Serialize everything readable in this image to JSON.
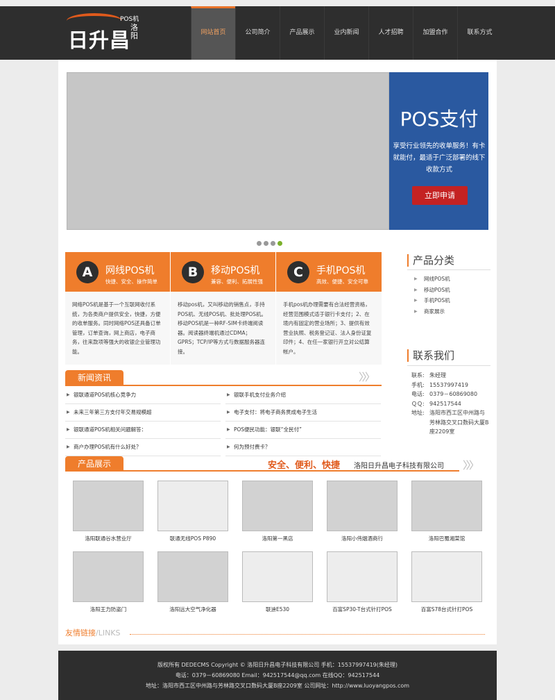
{
  "brand": {
    "logo_text": "日升昌",
    "logo_tag": "POS机",
    "logo_city": "洛阳"
  },
  "nav": [
    "网站首页",
    "公司简介",
    "产品展示",
    "业内新闻",
    "人才招聘",
    "加盟合作",
    "联系方式"
  ],
  "banner": {
    "title": "POS支付",
    "text": "享受行业领先的收单服务！有卡就能付，最适于广泛部署的线下收款方式",
    "button": "立即申请"
  },
  "features": [
    {
      "badge": "A",
      "title": "网线POS机",
      "sub": "快捷、安全、操作简单",
      "body": "网络POS机是基于一个互联网收付系统，为各类商户提供安全，快捷，方便的收单服务。同时网络POS还具备订单管理，订单查询，网上商店，电子商务，往来款项等强大的收银企业管理功能。"
    },
    {
      "badge": "B",
      "title": "移动POS机",
      "sub": "兼容、便利、拓展性强",
      "body": "移动pos机，又叫移动的销售点，手持POS机、无线POS机、批处理POS机。移动POS机是一种RF-SIM卡终端阅读器。阅读器终端机通过CDMA；GPRS；TCP/IP等方式与数据服务器连接。"
    },
    {
      "badge": "C",
      "title": "手机POS机",
      "sub": "高效、便捷、安全可靠",
      "body": "手机pos机办理需要有合法经营资格，经营范围模式适于银行卡支付；2、在境内有固定的营业场所；3、提供有效营业执照、税务登记证、法人身份证复印件；4、在任一家银行开立对公结算帐户。"
    }
  ],
  "sidebar": {
    "category_title": "产品分类",
    "categories": [
      "网线POS机",
      "移动POS机",
      "手机POS机",
      "商家展示"
    ],
    "contact_title": "联系我们",
    "contact": [
      {
        "k": "联系:",
        "v": "朱经理"
      },
      {
        "k": "手机:",
        "v": "15537997419"
      },
      {
        "k": "电话:",
        "v": "0379－60869080"
      },
      {
        "k": "ＱＱ:",
        "v": "942517544"
      },
      {
        "k": "地址:",
        "v": "洛阳市西工区中州路与芳林路交叉口数码大厦B座2209室"
      }
    ]
  },
  "news": {
    "tab": "新闻资讯",
    "left": [
      "银联通道POS机核心竞争力",
      "未来三年第三方支付年交易规模超",
      "银联通道POS机相关问题解答：",
      "商户办理POS机有什么好处？"
    ],
    "right": [
      "银联手机支付业务介绍",
      "电子支付：将电子商务贯成电子生活",
      "POS便民功能：银联“全民付”",
      "何为预付费卡？"
    ]
  },
  "products": {
    "tab": "产品展示",
    "slogan": "安全、便利、快捷",
    "company": "洛阳日升昌电子科技有限公司",
    "items": [
      "洛阳联通谷水营业厅",
      "联通无线POS P890",
      "洛阳第一黑店",
      "洛阳小伟烟酒商行",
      "洛阳巴蜀湘菜馆",
      "洛阳王力防盗门",
      "洛阳远大空气净化器",
      "联迪E530",
      "百富SP30-T台式针打POS",
      "百富S78台式针打POS"
    ]
  },
  "links": {
    "cn": "友情链接",
    "en": "/LINKS"
  },
  "footer": {
    "line1": "版权所有 DEDECMS Copyright © 洛阳日升昌电子科技有限公司 手机：15537997419(朱经理)",
    "line2": "电话：0379－60869080 Email：942517544@qq.com 在线QQ：942517544",
    "line3": "地址：洛阳市西工区中州路与芳林路交叉口数码大厦B座2209室 公司网址：http://www.luoyangpos.com"
  },
  "colors": {
    "accent": "#ef7d2c",
    "dark": "#2e2e2e",
    "banner_blue": "#2a59a0",
    "button_red": "#c42222"
  }
}
